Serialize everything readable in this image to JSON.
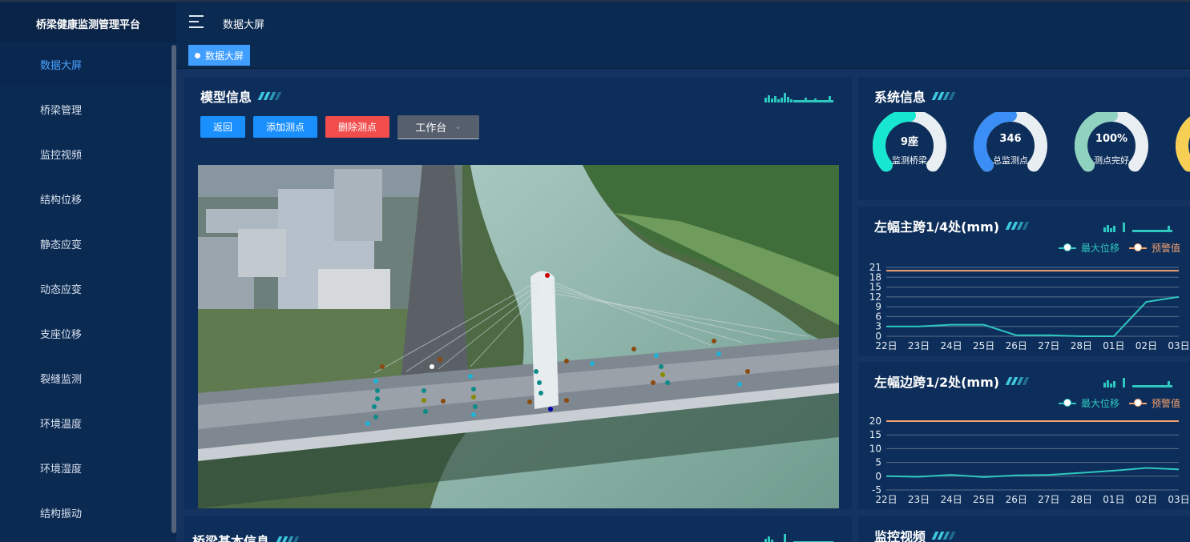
{
  "app": {
    "title": "桥梁健康监测管理平台",
    "page_title": "数据大屏"
  },
  "tabs": [
    {
      "label": "数据大屏"
    }
  ],
  "sidebar": {
    "items": [
      {
        "label": "数据大屏"
      },
      {
        "label": "桥梁管理"
      },
      {
        "label": "监控视频"
      },
      {
        "label": "结构位移"
      },
      {
        "label": "静态应变"
      },
      {
        "label": "动态应变"
      },
      {
        "label": "支座位移"
      },
      {
        "label": "裂缝监测"
      },
      {
        "label": "环境温度"
      },
      {
        "label": "环境湿度"
      },
      {
        "label": "结构振动"
      }
    ]
  },
  "model_panel": {
    "title": "模型信息",
    "buttons": {
      "back": "返回",
      "add": "添加测点",
      "delete": "删除测点",
      "workbench": "工作台"
    }
  },
  "bridge_panel": {
    "title": "桥梁基本信息"
  },
  "system_panel": {
    "title": "系统信息",
    "gauges": [
      {
        "value": "9座",
        "label": "监测桥梁",
        "fill": 0.5,
        "color": "#17e6d0"
      },
      {
        "value": "346",
        "label": "总监测点",
        "fill": 0.5,
        "color": "#3a8ef6"
      },
      {
        "value": "100%",
        "label": "测点完好",
        "fill": 0.5,
        "color": "#8fd2c0"
      },
      {
        "value": "",
        "label": "",
        "fill": 0.5,
        "color": "#f7cf55"
      }
    ]
  },
  "video_panel": {
    "title": "监控视频"
  },
  "legend": {
    "max": "最大位移",
    "warn": "预警值",
    "max_color": "#2ec7c0",
    "warn_color": "#f5a26f"
  },
  "chart_data": [
    {
      "type": "line",
      "title": "左幅主跨1/4处(mm)",
      "categories": [
        "22日",
        "23日",
        "24日",
        "25日",
        "26日",
        "27日",
        "28日",
        "01日",
        "02日",
        "03日"
      ],
      "ylim": [
        0,
        21
      ],
      "yticks": [
        0,
        3,
        6,
        9,
        12,
        15,
        18,
        21
      ],
      "series": [
        {
          "name": "最大位移",
          "values": [
            3,
            3,
            3.5,
            3.5,
            0.3,
            0.3,
            0,
            0,
            10.5,
            12
          ]
        },
        {
          "name": "预警值",
          "values": [
            20,
            20,
            20,
            20,
            20,
            20,
            20,
            20,
            20,
            20
          ]
        }
      ]
    },
    {
      "type": "line",
      "title": "左幅边跨1/2处(mm)",
      "categories": [
        "22日",
        "23日",
        "24日",
        "25日",
        "26日",
        "27日",
        "28日",
        "01日",
        "02日",
        "03日"
      ],
      "ylim": [
        -5,
        20
      ],
      "yticks": [
        -5,
        0,
        5,
        10,
        15,
        20
      ],
      "series": [
        {
          "name": "最大位移",
          "values": [
            0,
            -0.2,
            0.5,
            -0.3,
            0.3,
            0.5,
            1.2,
            2,
            3,
            2.5
          ]
        },
        {
          "name": "预警值",
          "values": [
            20,
            20,
            20,
            20,
            20,
            20,
            20,
            20,
            20,
            20
          ]
        }
      ]
    }
  ]
}
